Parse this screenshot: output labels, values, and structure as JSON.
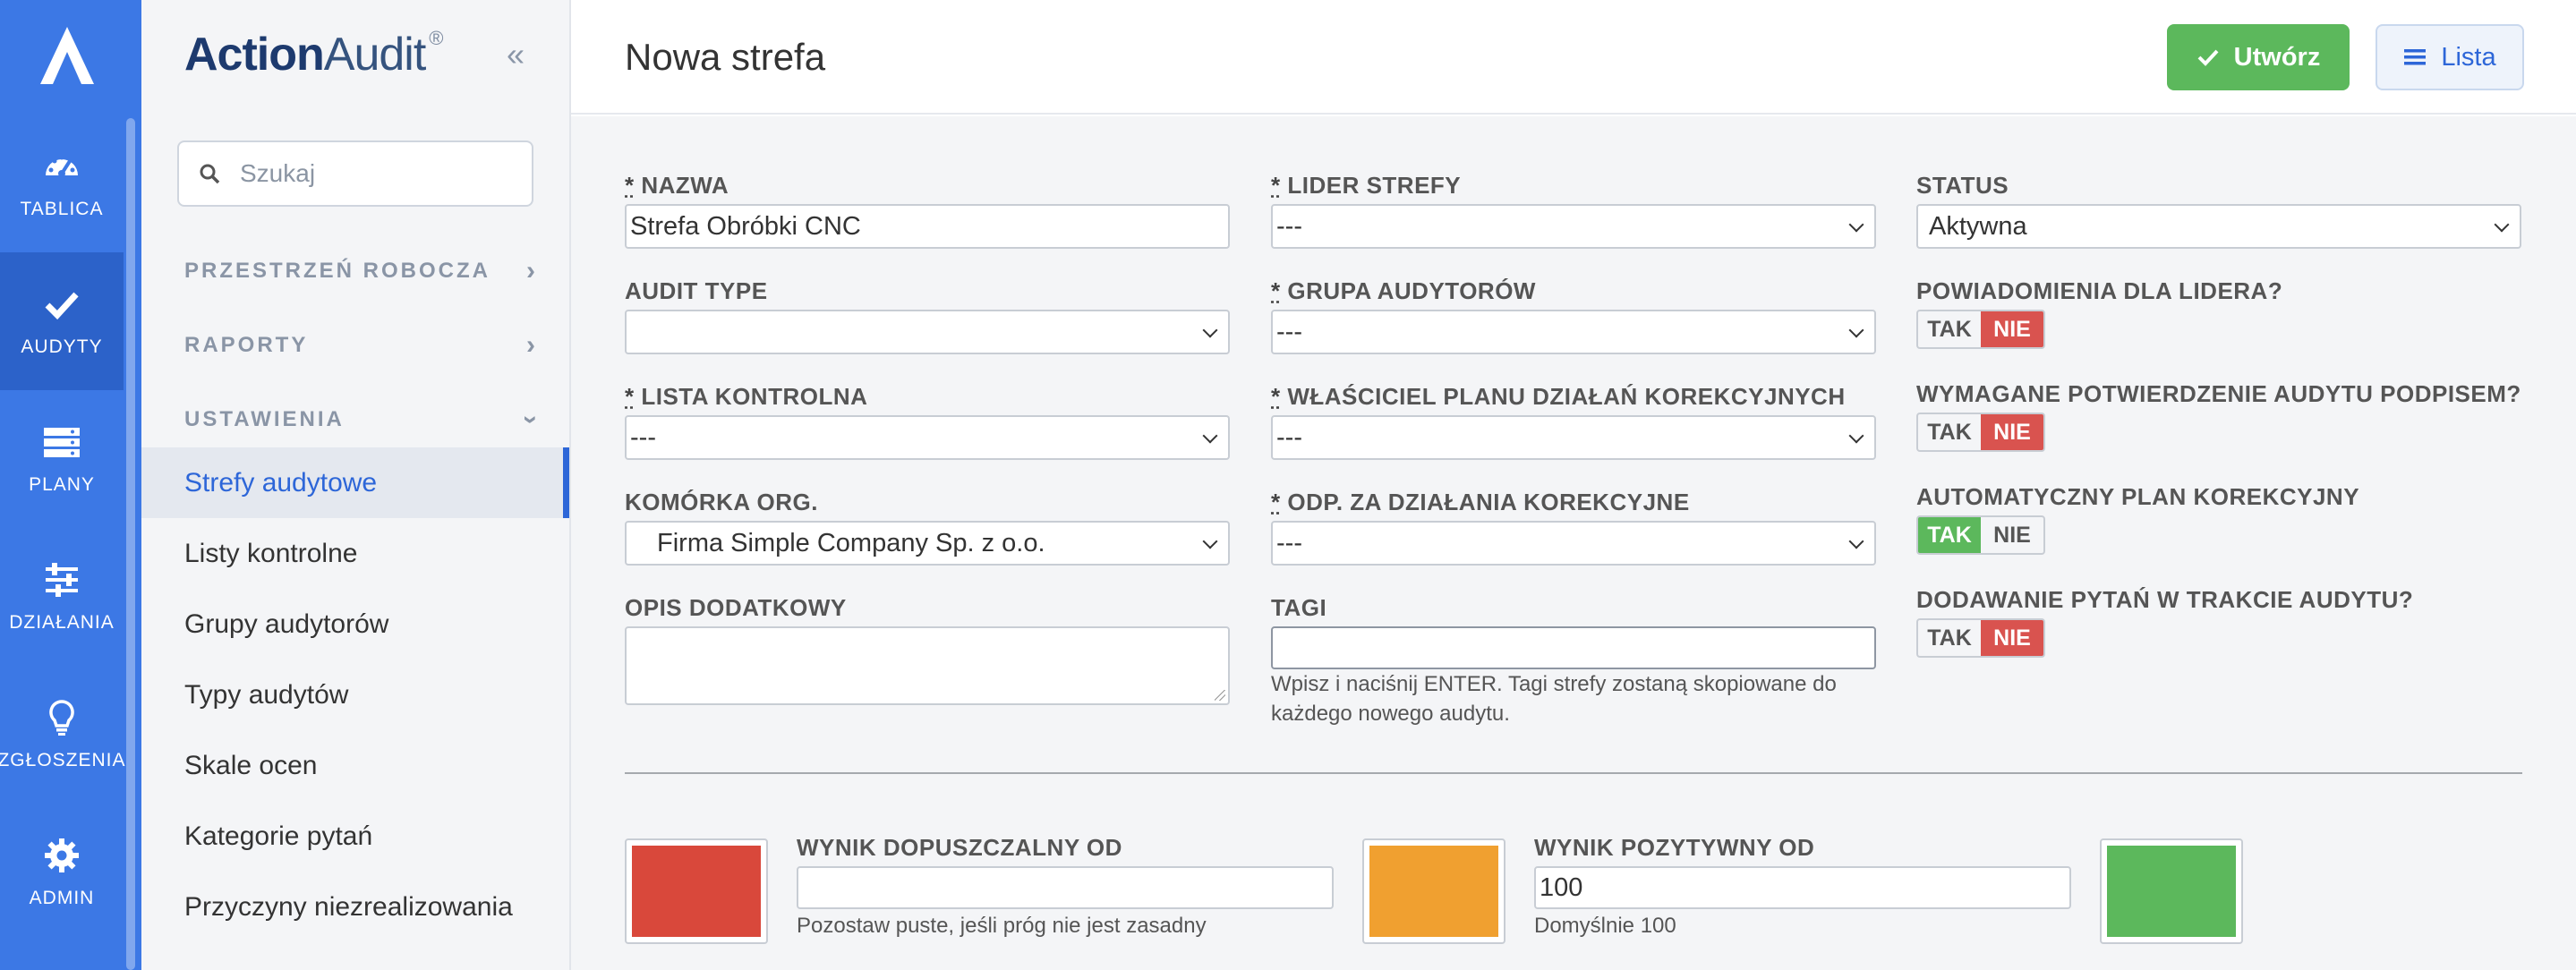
{
  "colors": {
    "rail": "#3c78e5",
    "rail_active": "#2c62c9",
    "accent": "#2d66d8",
    "green": "#5cb85c",
    "red": "#d9534f",
    "orange": "#f0a030"
  },
  "rail": {
    "items": [
      {
        "label": "TABLICA",
        "icon": "dashboard-icon"
      },
      {
        "label": "AUDYTY",
        "icon": "check-icon",
        "active": true
      },
      {
        "label": "PLANY",
        "icon": "server-icon"
      },
      {
        "label": "DZIAŁANIA",
        "icon": "sliders-icon"
      },
      {
        "label": "ZGŁOSZENIA",
        "icon": "lightbulb-icon"
      },
      {
        "label": "ADMIN",
        "icon": "gear-icon"
      }
    ]
  },
  "sidebar": {
    "brand_bold": "Action",
    "brand_light": "Audit",
    "brand_mark": "®",
    "search_placeholder": "Szukaj",
    "sections": [
      {
        "label": "PRZESTRZEŃ ROBOCZA"
      },
      {
        "label": "RAPORTY"
      },
      {
        "label": "USTAWIENIA"
      }
    ],
    "items": [
      {
        "label": "Strefy audytowe",
        "active": true
      },
      {
        "label": "Listy kontrolne"
      },
      {
        "label": "Grupy audytorów"
      },
      {
        "label": "Typy audytów"
      },
      {
        "label": "Skale ocen"
      },
      {
        "label": "Kategorie pytań"
      },
      {
        "label": "Przyczyny niezrealizowania"
      }
    ]
  },
  "header": {
    "title": "Nowa strefa",
    "create_label": "Utwórz",
    "list_label": "Lista"
  },
  "form": {
    "req_mark": "*",
    "name": {
      "label": "NAZWA",
      "value": "Strefa Obróbki CNC"
    },
    "audit_type": {
      "label": "AUDIT TYPE",
      "value": ""
    },
    "checklist": {
      "label": "LISTA KONTROLNA",
      "value": "---"
    },
    "org_unit": {
      "label": "KOMÓRKA ORG.",
      "value": "Firma Simple Company Sp. z o.o."
    },
    "extra_desc": {
      "label": "OPIS DODATKOWY"
    },
    "zone_leader": {
      "label": "LIDER STREFY",
      "value": "---"
    },
    "auditor_group": {
      "label": "GRUPA AUDYTORÓW",
      "value": "---"
    },
    "plan_owner": {
      "label": "WŁAŚCICIEL PLANU DZIAŁAŃ KOREKCYJNYCH",
      "value": "---"
    },
    "corrective_resp": {
      "label": "ODP. ZA DZIAŁANIA KOREKCYJNE",
      "value": "---"
    },
    "tags": {
      "label": "TAGI",
      "value": "",
      "help_line1": "Wpisz i naciśnij ENTER. Tagi strefy zostaną skopiowane do",
      "help_line2": "każdego nowego audytu."
    },
    "status": {
      "label": "STATUS",
      "value": "Aktywna"
    },
    "yes": "TAK",
    "no": "NIE",
    "toggles": [
      {
        "label": "POWIADOMIENIA DLA LIDERA?",
        "value": "NIE"
      },
      {
        "label": "WYMAGANE POTWIERDZENIE AUDYTU PODPISEM?",
        "value": "NIE"
      },
      {
        "label": "AUTOMATYCZNY PLAN KOREKCYJNY",
        "value": "TAK"
      },
      {
        "label": "DODAWANIE PYTAŃ W TRAKCIE AUDYTU?",
        "value": "NIE"
      }
    ],
    "threshold_acceptable": {
      "label": "WYNIK DOPUSZCZALNY OD",
      "value": "",
      "help": "Pozostaw puste, jeśli próg nie jest zasadny"
    },
    "threshold_positive": {
      "label": "WYNIK POZYTYWNY OD",
      "value": "100",
      "help": "Domyślnie 100"
    },
    "swatches": [
      "#d9483b",
      "#f0a030",
      "#5cb85c"
    ]
  }
}
